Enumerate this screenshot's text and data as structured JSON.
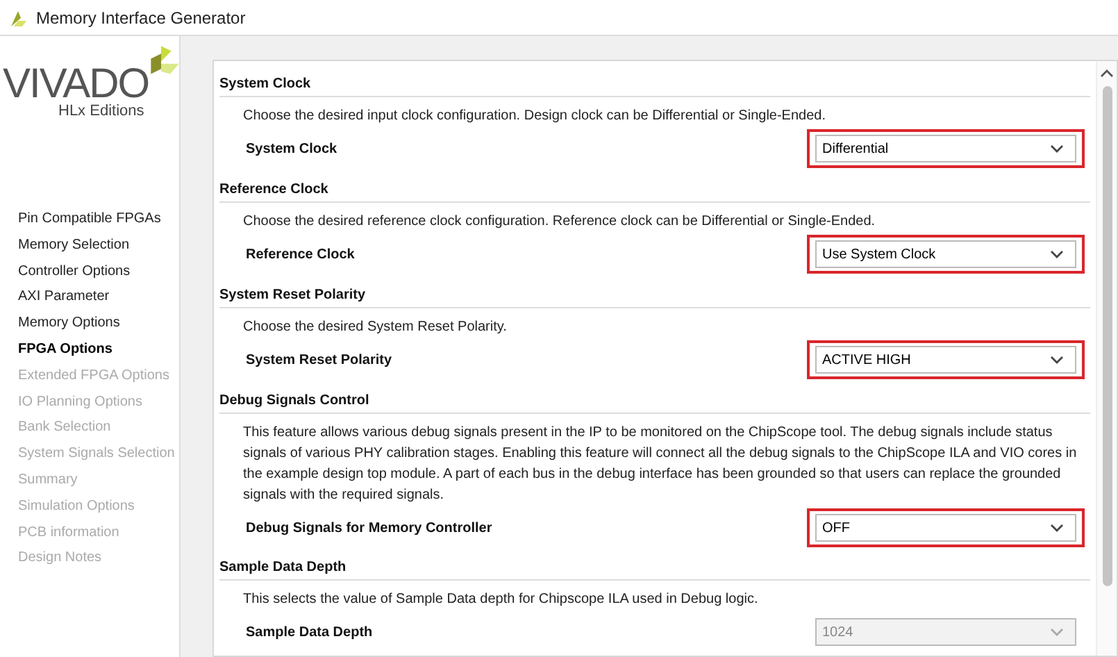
{
  "window": {
    "title": "Memory Interface Generator"
  },
  "logo": {
    "name": "VIVADO",
    "edition": "HLx Editions"
  },
  "sidebar": {
    "items": [
      {
        "label": "Pin Compatible FPGAs",
        "selected": false,
        "disabled": false
      },
      {
        "label": "Memory Selection",
        "selected": false,
        "disabled": false
      },
      {
        "label": "Controller Options",
        "selected": false,
        "disabled": false
      },
      {
        "label": "AXI Parameter",
        "selected": false,
        "disabled": false
      },
      {
        "label": "Memory Options",
        "selected": false,
        "disabled": false
      },
      {
        "label": "FPGA Options",
        "selected": true,
        "disabled": false
      },
      {
        "label": "Extended FPGA Options",
        "selected": false,
        "disabled": true
      },
      {
        "label": "IO Planning Options",
        "selected": false,
        "disabled": true
      },
      {
        "label": "Bank Selection",
        "selected": false,
        "disabled": true
      },
      {
        "label": "System Signals Selection",
        "selected": false,
        "disabled": true
      },
      {
        "label": "Summary",
        "selected": false,
        "disabled": true
      },
      {
        "label": "Simulation Options",
        "selected": false,
        "disabled": true
      },
      {
        "label": "PCB information",
        "selected": false,
        "disabled": true
      },
      {
        "label": "Design Notes",
        "selected": false,
        "disabled": true
      }
    ]
  },
  "sections": [
    {
      "title": "System Clock",
      "description": "Choose the desired input clock configuration. Design clock can be Differential or Single-Ended.",
      "label": "System Clock",
      "value": "Differential",
      "highlighted": true,
      "disabled": false
    },
    {
      "title": "Reference Clock",
      "description": "Choose the desired reference clock configuration. Reference clock can be Differential or Single-Ended.",
      "label": "Reference Clock",
      "value": "Use System Clock",
      "highlighted": true,
      "disabled": false
    },
    {
      "title": "System Reset Polarity",
      "description": "Choose the desired System Reset Polarity.",
      "label": "System Reset Polarity",
      "value": "ACTIVE HIGH",
      "highlighted": true,
      "disabled": false
    },
    {
      "title": "Debug Signals Control",
      "description": "This feature allows various debug signals present in the IP to be monitored on the ChipScope tool. The debug signals include status signals of various PHY calibration stages. Enabling this feature will connect all the debug signals to the ChipScope ILA and VIO cores in the example design top module. A part of each bus in the debug interface has been grounded so that users can replace the grounded signals with the required signals.",
      "label": "Debug Signals for Memory Controller",
      "value": "OFF",
      "highlighted": true,
      "disabled": false
    },
    {
      "title": "Sample Data Depth",
      "description": "This selects the value of Sample Data depth for Chipscope ILA used in Debug logic.",
      "label": "Sample Data Depth",
      "value": "1024",
      "highlighted": false,
      "disabled": true
    }
  ]
}
